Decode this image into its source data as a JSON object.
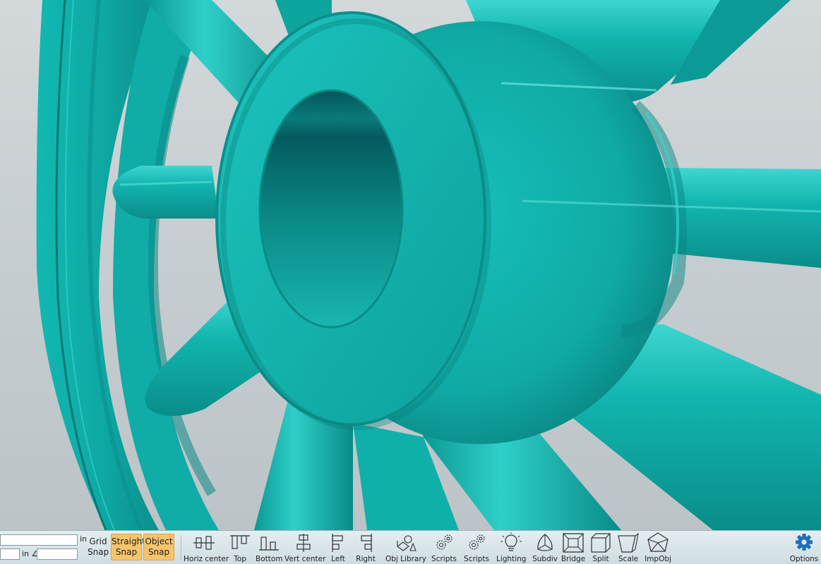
{
  "colors": {
    "model": "#0fb2ad",
    "background": "#c9cfd2",
    "toolbar_bg": "#d8e6ea",
    "snap_active": "#f5c46c",
    "accent": "#1d6fb8"
  },
  "viewport": {
    "content": "teal 3D wheel hub model"
  },
  "toolbar": {
    "distance_unit": "in",
    "angle_unit": "in ∠",
    "grid_snap": {
      "line1": "Grid",
      "line2": "Snap"
    },
    "straight_snap": {
      "line1": "Straight",
      "line2": "Snap",
      "active": true
    },
    "object_snap": {
      "line1": "Object",
      "line2": "Snap",
      "active": true
    },
    "tools": [
      {
        "label": "Horiz center",
        "icon": "horiz-center-icon"
      },
      {
        "label": "Top",
        "icon": "align-top-icon"
      },
      {
        "label": "Bottom",
        "icon": "align-bottom-icon"
      },
      {
        "label": "Vert center",
        "icon": "vert-center-icon"
      },
      {
        "label": "Left",
        "icon": "align-left-icon"
      },
      {
        "label": "Right",
        "icon": "align-right-icon"
      },
      {
        "label": "Obj Library",
        "icon": "obj-library-icon"
      },
      {
        "label": "Scripts",
        "icon": "scripts-gears-icon"
      },
      {
        "label": "Scripts",
        "icon": "scripts-gears-icon"
      },
      {
        "label": "Lighting",
        "icon": "lightbulb-icon"
      },
      {
        "label": "Subdiv",
        "icon": "subdiv-icon"
      },
      {
        "label": "Bridge",
        "icon": "bridge-icon"
      },
      {
        "label": "Split",
        "icon": "split-icon"
      },
      {
        "label": "Scale",
        "icon": "scale-icon"
      },
      {
        "label": "ImpObj",
        "icon": "impobj-icon"
      }
    ],
    "options": {
      "label": "Options",
      "icon": "gear-icon"
    }
  }
}
